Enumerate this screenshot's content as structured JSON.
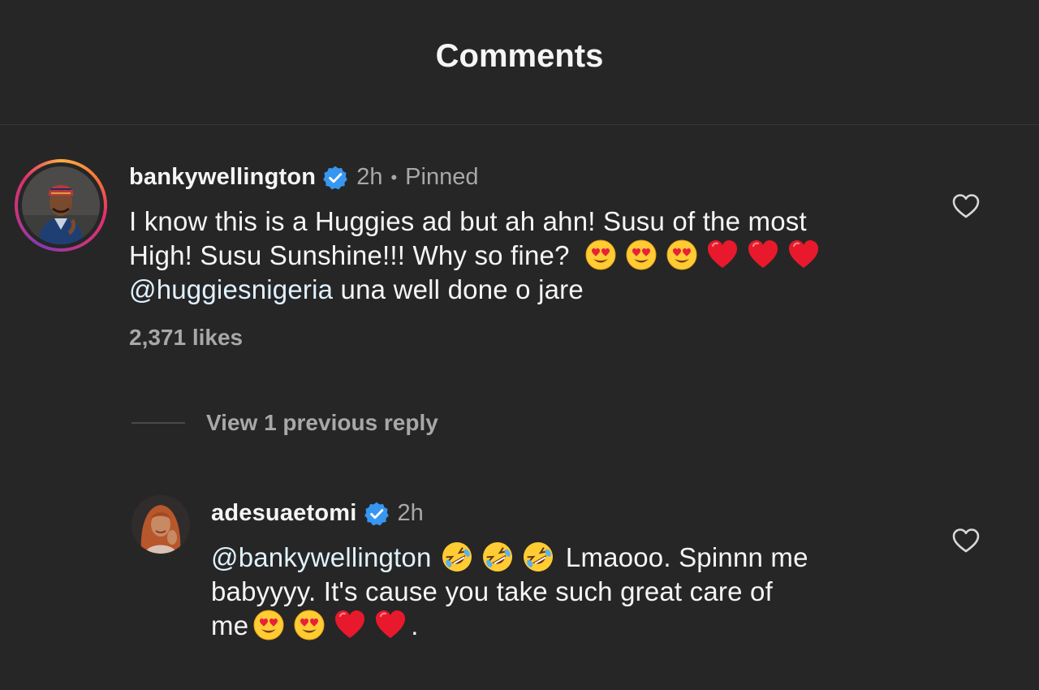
{
  "header": {
    "title": "Comments"
  },
  "comments": [
    {
      "username": "bankywellington",
      "verified": true,
      "time": "2h",
      "pinned_label": "Pinned",
      "text_line1": "I know this is a Huggies ad but ah ahn! Susu of the most",
      "text_line2": "High! Susu Sunshine!!! Why so fine?",
      "mention": "@huggiesnigeria",
      "text_line3_rest": " una well done o jare",
      "emojis": [
        "heart-eyes",
        "heart-eyes",
        "heart-eyes",
        "red-heart",
        "red-heart",
        "red-heart"
      ],
      "likes": "2,371 likes"
    }
  ],
  "view_replies": {
    "label": "View 1 previous reply"
  },
  "reply": {
    "username": "adesuaetomi",
    "verified": true,
    "time": "2h",
    "mention": "@bankywellington",
    "emojis_after_mention": [
      "rofl",
      "rofl",
      "rofl"
    ],
    "text_after_emojis": "Lmaooo. Spinnn me",
    "text_line2": "babyyyy. It's cause you take such great care of",
    "text_line3": "me",
    "emojis_end": [
      "heart-eyes",
      "heart-eyes",
      "red-heart",
      "red-heart"
    ],
    "text_end": "."
  },
  "colors": {
    "background": "#262626",
    "text_primary": "#f5f5f5",
    "text_secondary": "#a8a8a8",
    "mention": "#e0f1ff",
    "verified_badge": "#3797f0"
  }
}
